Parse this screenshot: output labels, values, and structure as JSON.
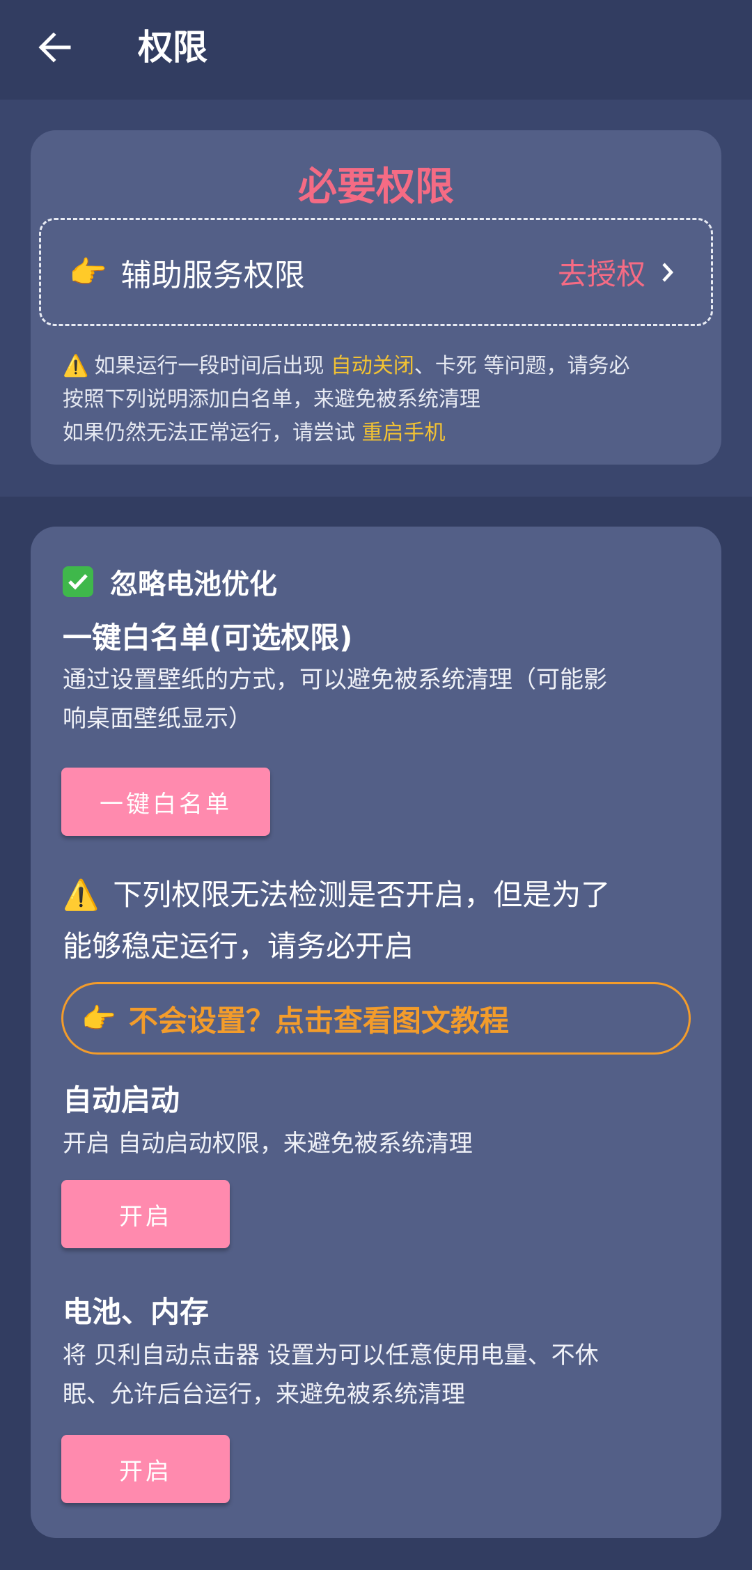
{
  "header": {
    "title": "权限",
    "back_icon": "arrow-left-icon"
  },
  "required_card": {
    "title": "必要权限",
    "accessibility": {
      "icon": "pointing-hand-icon",
      "label": "辅助服务权限",
      "action": "去授权"
    },
    "note": {
      "line1_prefix": "如果运行一段时间后出现",
      "line1_highlight1": "自动关闭",
      "line1_middle": "、卡死",
      "line1_suffix": "等问题，请务必",
      "line2": "按照下列说明添加白名单，来避免被系统清理",
      "line3_prefix": "如果仍然无法正常运行，请尝试",
      "line3_highlight": "重启手机"
    }
  },
  "optional_card": {
    "battery_opt": {
      "icon": "checkmark-icon",
      "label": "忽略电池优化"
    },
    "whitelist": {
      "title": "一键白名单(可选权限)",
      "description_line1": "通过设置壁纸的方式，可以避免被系统清理（可能影",
      "description_line2": "响桌面壁纸显示）",
      "button": "一键白名单"
    },
    "warning": {
      "line1": "下列权限无法检测是否开启，但是为了",
      "line2": "能够稳定运行，请务必开启"
    },
    "tutorial": {
      "label": "不会设置？点击查看图文教程"
    },
    "auto_start": {
      "title": "自动启动",
      "description_prefix": "开启",
      "description_suffix": "自动启动权限，来避免被系统清理",
      "button": "开启"
    },
    "battery_memory": {
      "title": "电池、内存",
      "description_line1_prefix": "将",
      "description_line1_app": "贝利自动点击器",
      "description_line1_suffix": "设置为可以任意使用电量、不休",
      "description_line2": "眠、允许后台运行，来避免被系统清理",
      "button": "开启"
    }
  },
  "colors": {
    "background": "#323d61",
    "card": "#535f87",
    "accent_pink": "#f56b84",
    "button_pink": "#ff8aae",
    "highlight_yellow": "#f2c233",
    "tutorial_orange": "#f39c2b"
  }
}
